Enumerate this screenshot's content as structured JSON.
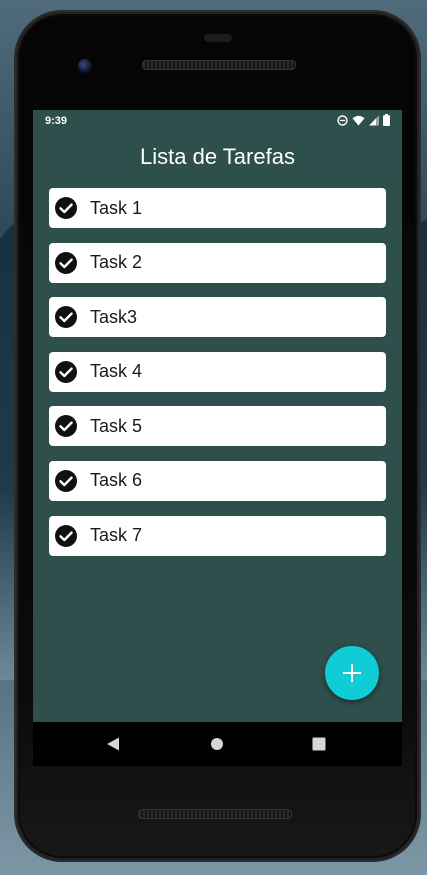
{
  "status_bar": {
    "time": "9:39",
    "icons": [
      "do-not-disturb-icon",
      "wifi-icon",
      "signal-icon",
      "battery-icon"
    ]
  },
  "app": {
    "title": "Lista de Tarefas",
    "tasks": [
      {
        "label": "Task 1",
        "done": true
      },
      {
        "label": "Task 2",
        "done": true
      },
      {
        "label": "Task3",
        "done": true
      },
      {
        "label": "Task 4",
        "done": true
      },
      {
        "label": "Task 5",
        "done": true
      },
      {
        "label": "Task 6",
        "done": true
      },
      {
        "label": "Task 7",
        "done": true
      }
    ],
    "fab_icon": "plus-icon"
  },
  "nav_bar": {
    "buttons": [
      "back-icon",
      "home-icon",
      "recents-icon"
    ]
  },
  "colors": {
    "screen_background": "#2e4f4c",
    "task_background": "#ffffff",
    "fab": "#10ccd4",
    "status_text": "#ffffff"
  }
}
